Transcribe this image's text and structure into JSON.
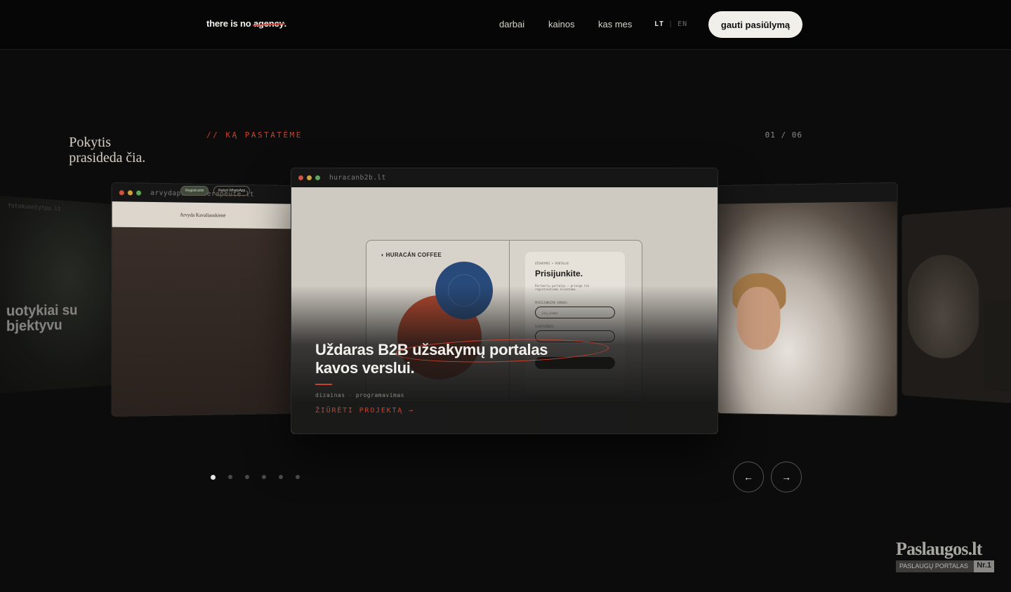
{
  "header": {
    "logo_prefix": "there is no ",
    "logo_struck": "agency",
    "logo_suffix": ".",
    "nav": [
      "darbai",
      "kainos",
      "kas mes"
    ],
    "lang_active": "LT",
    "lang_sep": "|",
    "lang_other": "EN",
    "cta_label": "gauti pasiūlymą"
  },
  "section": {
    "eyebrow": "// KĄ PASTATĖME",
    "counter": "01 / 06"
  },
  "cards": {
    "far_left": {
      "url": "fotokuontytpu.lt",
      "title_line1": "uotykiai su",
      "title_line2": "bjektyvu"
    },
    "left": {
      "url": "arvydapsichoterapeute.lt",
      "brand": "Arvyda Kavaliauskienė",
      "headline_line1": "Pokytis",
      "headline_line2": "prasideda čia.",
      "btn1": "Registruotis",
      "btn2": "Rašyti WhatsApp"
    },
    "center": {
      "url": "huracanb2b.lt",
      "mock_logo": "HURACÁN COFFEE",
      "mock_label": "UŽSAKYMAI • PORTALAS",
      "mock_title": "Prisijunkite.",
      "mock_sub": "Partnerių portalas — prieiga tik registruotiems klientams.",
      "mock_field1_label": "PRISIJUNGIMO VARDAS",
      "mock_field1_placeholder": "jūsų_kodas",
      "mock_field2_label": "SLAPTAŽODIS"
    },
    "right": {
      "url": ""
    },
    "far_right": {
      "url": ""
    }
  },
  "project": {
    "title_line1": "Uždaras B2B užsakymų portalas",
    "title_line2": "kavos verslui.",
    "tags": [
      "dizainas",
      "programavimas"
    ],
    "tag_sep": "·",
    "link": "ŽIŪRĖTI PROJEKTĄ →"
  },
  "pager": {
    "total": 6,
    "active": 0
  },
  "arrows": {
    "prev": "←",
    "next": "→"
  },
  "badge": {
    "title": "Paslaugos.lt",
    "subtitle": "PASLAUGŲ PORTALAS",
    "rank": "Nr.1"
  },
  "colors": {
    "accent": "#c8412e",
    "bg": "#0c0c0c",
    "cta_bg": "#f1efe9"
  }
}
